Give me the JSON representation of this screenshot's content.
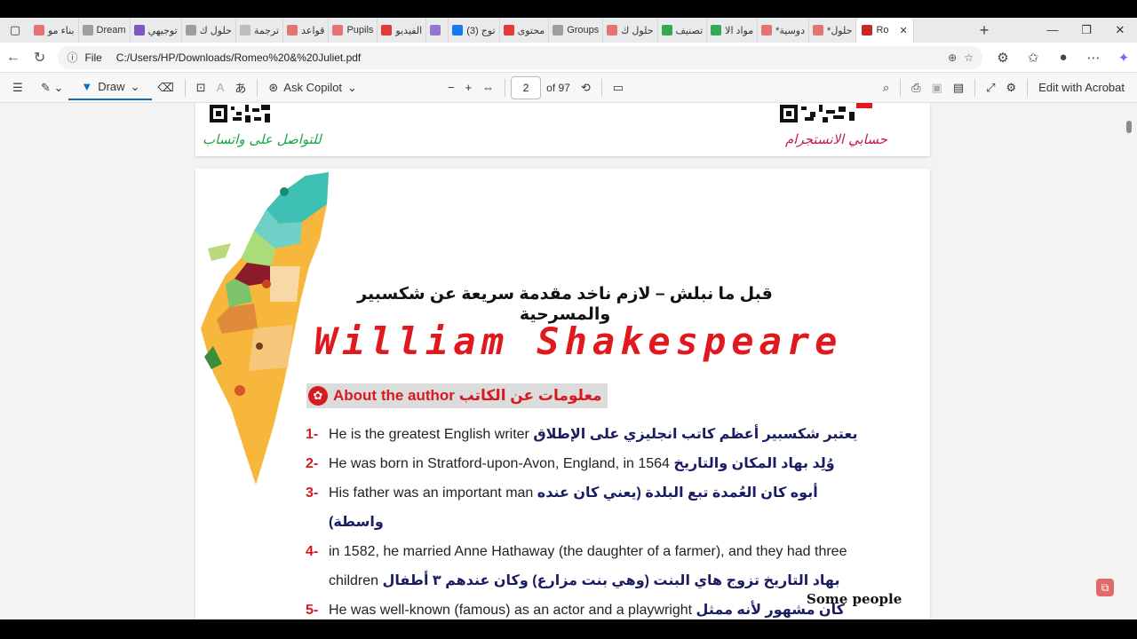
{
  "tabs": [
    {
      "label": "بناء مو",
      "color": "#e57373"
    },
    {
      "label": "Dream",
      "color": "#9e9e9e"
    },
    {
      "label": "توجيهي",
      "color": "#7e57c2"
    },
    {
      "label": "حلول ك",
      "color": "#9e9e9e"
    },
    {
      "label": "ترجمة",
      "color": "#bdbdbd"
    },
    {
      "label": "قواعد",
      "color": "#e57373"
    },
    {
      "label": "Pupils",
      "color": "#e57373"
    },
    {
      "label": "الفيديو",
      "color": "#e53935"
    },
    {
      "label": "",
      "color": "#9575cd"
    },
    {
      "label": "(3) توج",
      "color": "#1877f2"
    },
    {
      "label": "محتوى",
      "color": "#e53935"
    },
    {
      "label": "Groups",
      "color": "#9e9e9e"
    },
    {
      "label": "حلول ك",
      "color": "#e57373"
    },
    {
      "label": "تصنيف",
      "color": "#34a853"
    },
    {
      "label": "مواد الا",
      "color": "#34a853"
    },
    {
      "label": "*دوسية",
      "color": "#e57373"
    },
    {
      "label": "*حلول",
      "color": "#e57373"
    },
    {
      "label": "Ro",
      "color": "#c62828",
      "active": true
    }
  ],
  "address": {
    "scheme": "File",
    "url": "C:/Users/HP/Downloads/Romeo%20&%20Juliet.pdf"
  },
  "toolbar": {
    "draw_label": "Draw",
    "ask_copilot_label": "Ask Copilot",
    "page_current": "2",
    "page_total": "of 97",
    "edit_acrobat_label": "Edit with Acrobat"
  },
  "header_prev": {
    "whatsapp_text": "للتواصل على واتساب",
    "instagram_text": "حسابي الانستجرام"
  },
  "page": {
    "title_ar": "قبل ما نبلش – لازم ناخد مقدمة سريعة عن شكسبير والمسرحية",
    "author_name": "William Shakespeare",
    "about_label": "About the author معلومات عن الكاتب",
    "items": [
      {
        "num": "1-",
        "en": "He is the greatest English writer",
        "ar": "يعتبر شكسبير أعظم كاتب انجليزي على الإطلاق"
      },
      {
        "num": "2-",
        "en": "He was born in Stratford-upon-Avon, England, in 1564",
        "ar": "وُلِد بهاد المكان والتاريخ"
      },
      {
        "num": "3-",
        "en": "His father was an important man",
        "ar": "أبوه كان العُمدة تبع البلدة (يعني كان عنده واسطة)"
      },
      {
        "num": "4-",
        "en": "in 1582, he married Anne Hathaway (the daughter of a farmer), and they had three children",
        "ar": "بهاد التاريخ تزوج هاي البنت (وهي بنت مزارع) وكان عندهم ٣ أطفال"
      },
      {
        "num": "5-",
        "en": "He was well-known (famous) as an actor and a playwright",
        "ar": "كان مشهور لأنه ممثل وكاتب مسرحي"
      }
    ],
    "some_people": "Some people"
  },
  "colors": {
    "accent": "#0f6cbd",
    "author_red": "#e0191f",
    "arabic_navy": "#1b1d63"
  }
}
